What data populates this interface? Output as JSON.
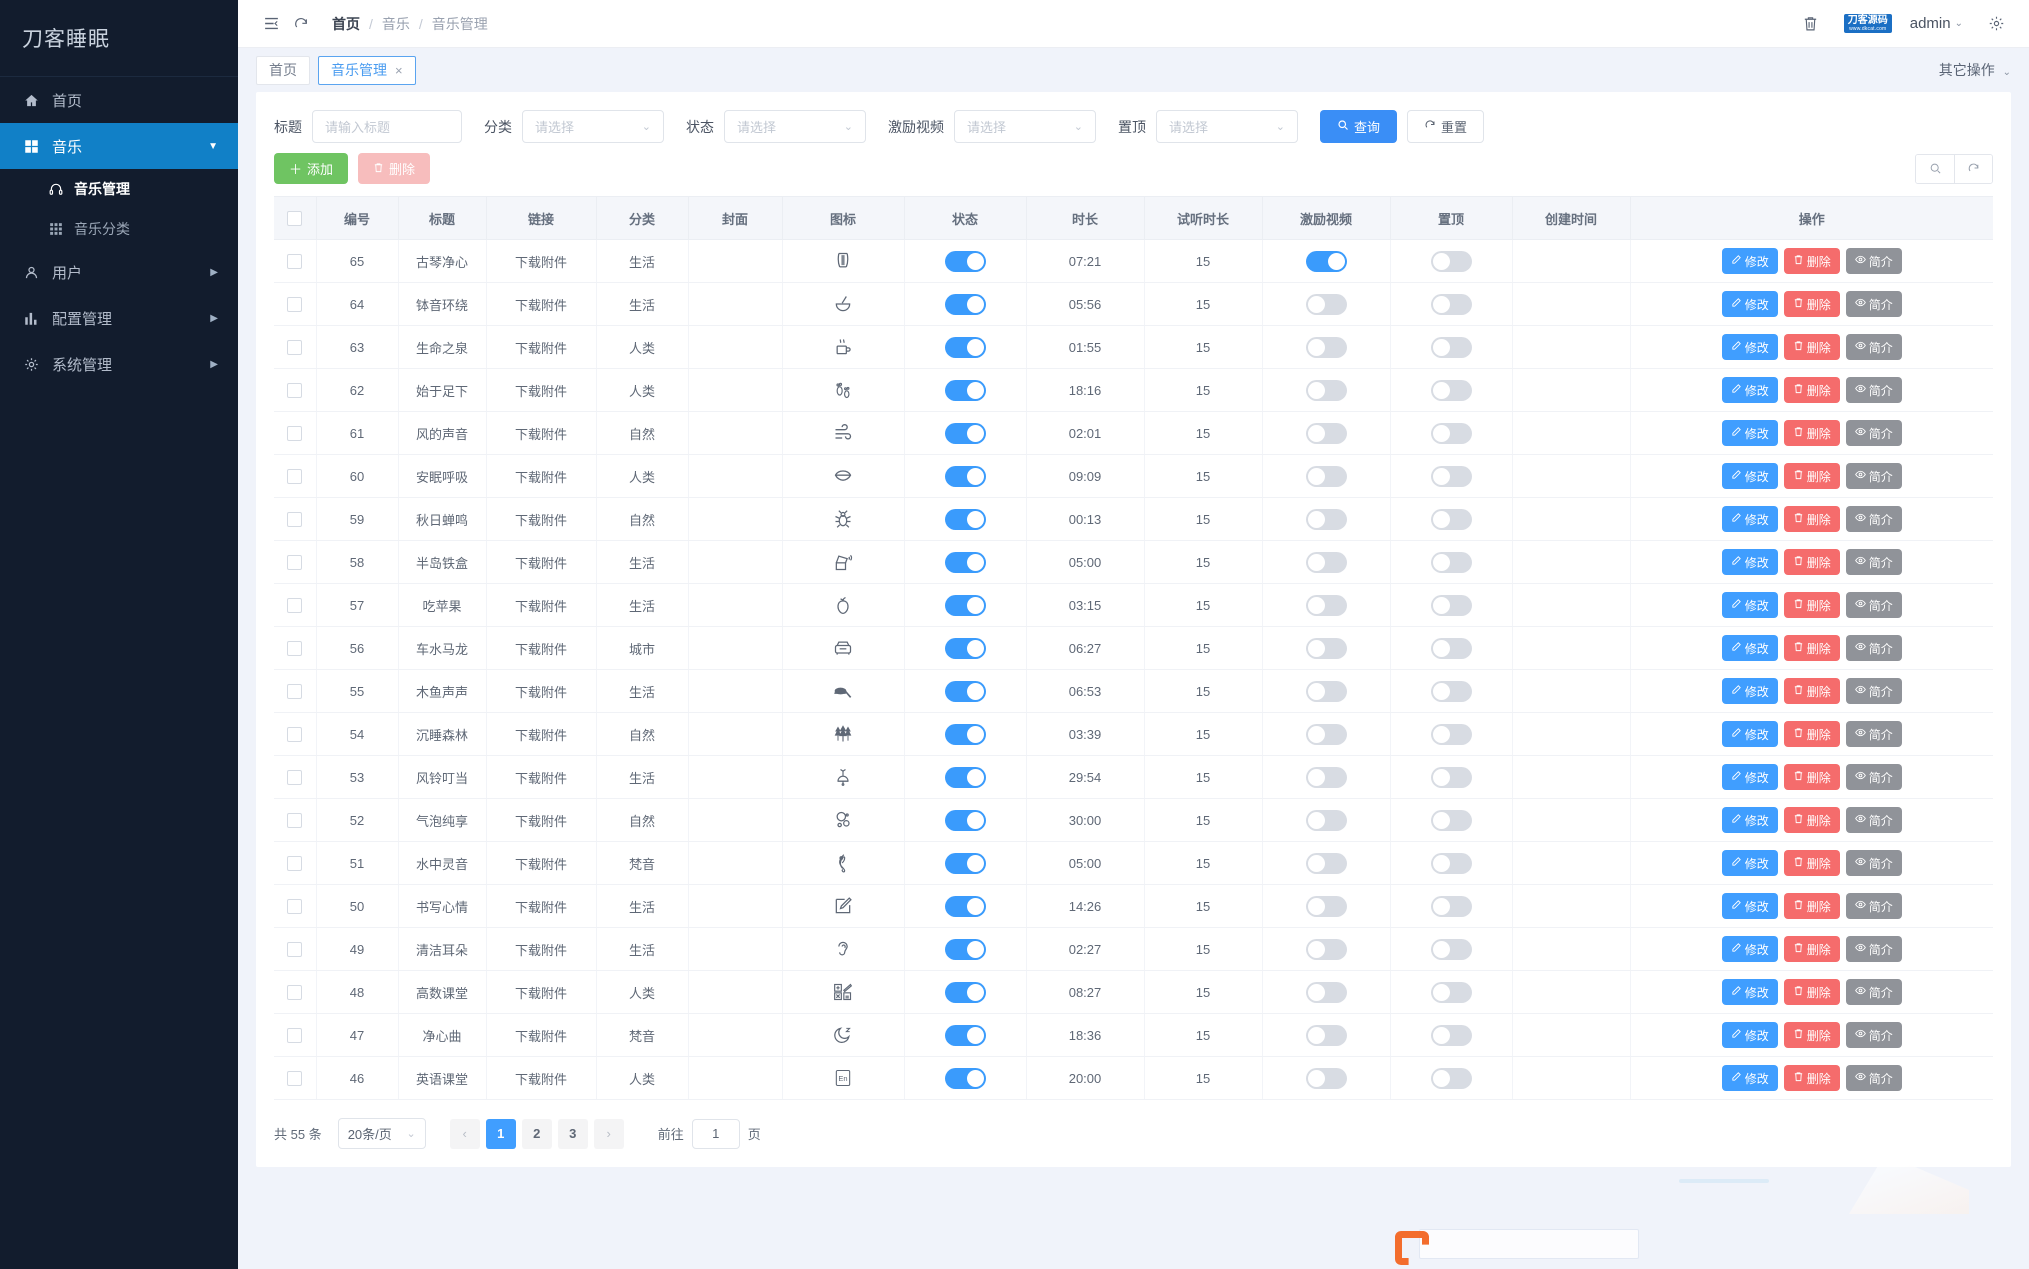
{
  "sidebar": {
    "brand": "刀客睡眠",
    "items": [
      {
        "label": "首页",
        "icon": "home-icon",
        "active": false,
        "expandable": false
      },
      {
        "label": "音乐",
        "icon": "grid-icon",
        "active": true,
        "expandable": true,
        "expanded": true
      },
      {
        "label": "用户",
        "icon": "user-icon",
        "active": false,
        "expandable": true
      },
      {
        "label": "配置管理",
        "icon": "chart-icon",
        "active": false,
        "expandable": true
      },
      {
        "label": "系统管理",
        "icon": "gear-icon",
        "active": false,
        "expandable": true
      }
    ],
    "sub_items": [
      {
        "label": "音乐管理",
        "icon": "headphones-icon",
        "active": true
      },
      {
        "label": "音乐分类",
        "icon": "grid-small-icon",
        "active": false
      }
    ]
  },
  "topbar": {
    "menu_icon": "collapse-menu-icon",
    "refresh_icon": "refresh-icon",
    "breadcrumb": [
      "首页",
      "音乐",
      "音乐管理"
    ],
    "trash_icon": "trash-icon",
    "logo_text": "刀客源码",
    "logo_sub": "www.dkcat.com",
    "user": "admin",
    "settings_icon": "gear-icon"
  },
  "tabbar": {
    "tabs": [
      {
        "label": "首页",
        "active": false,
        "closable": false
      },
      {
        "label": "音乐管理",
        "active": true,
        "closable": true
      }
    ],
    "other_actions": "其它操作"
  },
  "filters": {
    "title_label": "标题",
    "title_placeholder": "请输入标题",
    "title_value": "",
    "category_label": "分类",
    "category_placeholder": "请选择",
    "status_label": "状态",
    "status_placeholder": "请选择",
    "reward_video_label": "激励视频",
    "reward_video_placeholder": "请选择",
    "pin_label": "置顶",
    "pin_placeholder": "请选择",
    "search_button": "查询",
    "reset_button": "重置"
  },
  "toolbar": {
    "add_label": "添加",
    "delete_label": "删除",
    "search_icon": "search-icon",
    "refresh_icon": "refresh-icon"
  },
  "table": {
    "columns": [
      "",
      "编号",
      "标题",
      "链接",
      "分类",
      "封面",
      "图标",
      "状态",
      "时长",
      "试听时长",
      "激励视频",
      "置顶",
      "创建时间",
      "操作"
    ],
    "link_text": "下载附件",
    "ops": {
      "edit": "修改",
      "delete": "删除",
      "info": "简介"
    },
    "rows": [
      {
        "id": "65",
        "title": "古琴净心",
        "link": "下载附件",
        "category": "生活",
        "cover": "",
        "icon": "lyre-icon",
        "status": true,
        "duration": "07:21",
        "trial": "15",
        "reward": true,
        "pin": false,
        "created": ""
      },
      {
        "id": "64",
        "title": "钵音环绕",
        "link": "下载附件",
        "category": "生活",
        "cover": "",
        "icon": "mortar-icon",
        "status": true,
        "duration": "05:56",
        "trial": "15",
        "reward": false,
        "pin": false,
        "created": ""
      },
      {
        "id": "63",
        "title": "生命之泉",
        "link": "下载附件",
        "category": "人类",
        "cover": "",
        "icon": "hot-cup-icon",
        "status": true,
        "duration": "01:55",
        "trial": "15",
        "reward": false,
        "pin": false,
        "created": ""
      },
      {
        "id": "62",
        "title": "始于足下",
        "link": "下载附件",
        "category": "人类",
        "cover": "",
        "icon": "footprints-icon",
        "status": true,
        "duration": "18:16",
        "trial": "15",
        "reward": false,
        "pin": false,
        "created": ""
      },
      {
        "id": "61",
        "title": "风的声音",
        "link": "下载附件",
        "category": "自然",
        "cover": "",
        "icon": "wind-icon",
        "status": true,
        "duration": "02:01",
        "trial": "15",
        "reward": false,
        "pin": false,
        "created": ""
      },
      {
        "id": "60",
        "title": "安眠呼吸",
        "link": "下载附件",
        "category": "人类",
        "cover": "",
        "icon": "mouth-icon",
        "status": true,
        "duration": "09:09",
        "trial": "15",
        "reward": false,
        "pin": false,
        "created": ""
      },
      {
        "id": "59",
        "title": "秋日蝉鸣",
        "link": "下载附件",
        "category": "自然",
        "cover": "",
        "icon": "bug-icon",
        "status": true,
        "duration": "00:13",
        "trial": "15",
        "reward": false,
        "pin": false,
        "created": ""
      },
      {
        "id": "58",
        "title": "半岛铁盒",
        "link": "下载附件",
        "category": "生活",
        "cover": "",
        "icon": "tin-box-icon",
        "status": true,
        "duration": "05:00",
        "trial": "15",
        "reward": false,
        "pin": false,
        "created": ""
      },
      {
        "id": "57",
        "title": "吃苹果",
        "link": "下载附件",
        "category": "生活",
        "cover": "",
        "icon": "apple-icon",
        "status": true,
        "duration": "03:15",
        "trial": "15",
        "reward": false,
        "pin": false,
        "created": ""
      },
      {
        "id": "56",
        "title": "车水马龙",
        "link": "下载附件",
        "category": "城市",
        "cover": "",
        "icon": "car-icon",
        "status": true,
        "duration": "06:27",
        "trial": "15",
        "reward": false,
        "pin": false,
        "created": ""
      },
      {
        "id": "55",
        "title": "木鱼声声",
        "link": "下载附件",
        "category": "生活",
        "cover": "",
        "icon": "wooden-fish-icon",
        "status": true,
        "duration": "06:53",
        "trial": "15",
        "reward": false,
        "pin": false,
        "created": ""
      },
      {
        "id": "54",
        "title": "沉睡森林",
        "link": "下载附件",
        "category": "自然",
        "cover": "",
        "icon": "forest-icon",
        "status": true,
        "duration": "03:39",
        "trial": "15",
        "reward": false,
        "pin": false,
        "created": ""
      },
      {
        "id": "53",
        "title": "风铃叮当",
        "link": "下载附件",
        "category": "生活",
        "cover": "",
        "icon": "bell-icon",
        "status": true,
        "duration": "29:54",
        "trial": "15",
        "reward": false,
        "pin": false,
        "created": ""
      },
      {
        "id": "52",
        "title": "气泡纯享",
        "link": "下载附件",
        "category": "自然",
        "cover": "",
        "icon": "bubbles-icon",
        "status": true,
        "duration": "30:00",
        "trial": "15",
        "reward": false,
        "pin": false,
        "created": ""
      },
      {
        "id": "51",
        "title": "水中灵音",
        "link": "下载附件",
        "category": "梵音",
        "cover": "",
        "icon": "treble-clef-icon",
        "status": true,
        "duration": "05:00",
        "trial": "15",
        "reward": false,
        "pin": false,
        "created": ""
      },
      {
        "id": "50",
        "title": "书写心情",
        "link": "下载附件",
        "category": "生活",
        "cover": "",
        "icon": "pencil-icon",
        "status": true,
        "duration": "14:26",
        "trial": "15",
        "reward": false,
        "pin": false,
        "created": ""
      },
      {
        "id": "49",
        "title": "清洁耳朵",
        "link": "下载附件",
        "category": "生活",
        "cover": "",
        "icon": "ear-icon",
        "status": true,
        "duration": "02:27",
        "trial": "15",
        "reward": false,
        "pin": false,
        "created": ""
      },
      {
        "id": "48",
        "title": "高数课堂",
        "link": "下载附件",
        "category": "人类",
        "cover": "",
        "icon": "calculator-icon",
        "status": true,
        "duration": "08:27",
        "trial": "15",
        "reward": false,
        "pin": false,
        "created": ""
      },
      {
        "id": "47",
        "title": "净心曲",
        "link": "下载附件",
        "category": "梵音",
        "cover": "",
        "icon": "moon-sleep-icon",
        "status": true,
        "duration": "18:36",
        "trial": "15",
        "reward": false,
        "pin": false,
        "created": ""
      },
      {
        "id": "46",
        "title": "英语课堂",
        "link": "下载附件",
        "category": "人类",
        "cover": "",
        "icon": "english-icon",
        "status": true,
        "duration": "20:00",
        "trial": "15",
        "reward": false,
        "pin": false,
        "created": ""
      }
    ]
  },
  "pagination": {
    "total_text": "共 55 条",
    "page_size": "20条/页",
    "prev": "‹",
    "pages": [
      "1",
      "2",
      "3"
    ],
    "current_page": "1",
    "next": "›",
    "jump_prefix": "前往",
    "jump_value": "1",
    "jump_suffix": "页"
  },
  "colors": {
    "sidebar_bg": "#121c2d",
    "accent": "#409eff",
    "active_nav": "#1180c7",
    "green": "#6fc462",
    "red": "#f56c6c",
    "gray": "#909399"
  }
}
